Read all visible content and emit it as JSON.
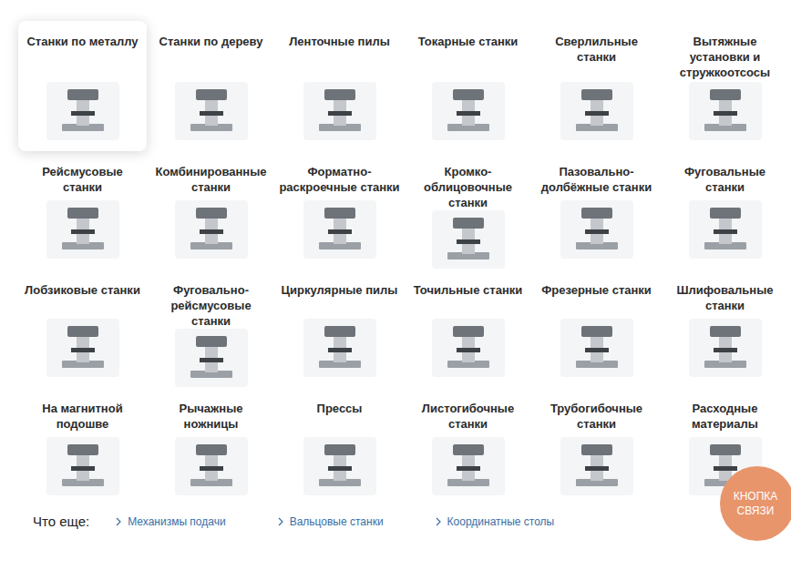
{
  "catalog": {
    "items": [
      {
        "title": "Станки по металлу",
        "selected": true
      },
      {
        "title": "Станки по дереву",
        "selected": false
      },
      {
        "title": "Ленточные пилы",
        "selected": false
      },
      {
        "title": "Токарные станки",
        "selected": false
      },
      {
        "title": "Сверлильные станки",
        "selected": false
      },
      {
        "title": "Вытяжные установки и стружкоотсосы",
        "selected": false
      },
      {
        "title": "Рейсмусовые станки",
        "selected": false
      },
      {
        "title": "Комбинированные станки",
        "selected": false
      },
      {
        "title": "Форматно-раскроечные станки",
        "selected": false
      },
      {
        "title": "Кромко-облицовочные станки",
        "selected": false
      },
      {
        "title": "Пазовально-долбёжные станки",
        "selected": false
      },
      {
        "title": "Фуговальные станки",
        "selected": false
      },
      {
        "title": "Лобзиковые станки",
        "selected": false
      },
      {
        "title": "Фуговально-рейсмусовые станки",
        "selected": false
      },
      {
        "title": "Циркулярные пилы",
        "selected": false
      },
      {
        "title": "Точильные станки",
        "selected": false
      },
      {
        "title": "Фрезерные станки",
        "selected": false
      },
      {
        "title": "Шлифовальные станки",
        "selected": false
      },
      {
        "title": "На магнитной подошве",
        "selected": false
      },
      {
        "title": "Рычажные ножницы",
        "selected": false
      },
      {
        "title": "Прессы",
        "selected": false
      },
      {
        "title": "Листогибочные станки",
        "selected": false
      },
      {
        "title": "Трубогибочные станки",
        "selected": false
      },
      {
        "title": "Расходные материалы",
        "selected": false
      }
    ]
  },
  "more": {
    "label": "Что еще:",
    "links": [
      "Механизмы подачи",
      "Вальцовые станки",
      "Координатные столы"
    ]
  },
  "contact_button": {
    "label": "КНОПКА СВЯЗИ"
  }
}
